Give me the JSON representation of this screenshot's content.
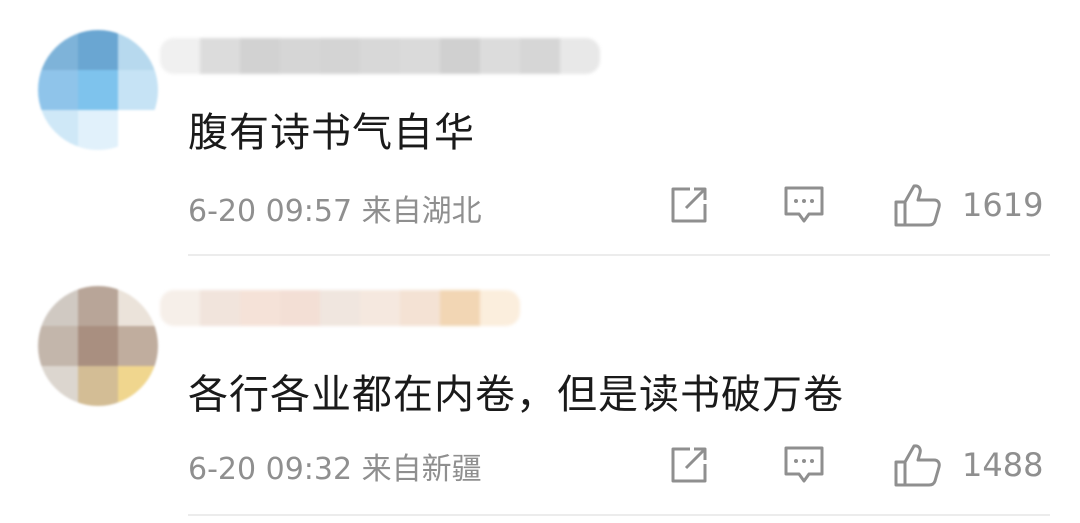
{
  "comments": [
    {
      "text": "腹有诗书气自华",
      "time": "6-20 09:57",
      "location": "来自湖北",
      "likes": "1619",
      "avatar_colors": [
        "#7eb3d9",
        "#6aa6d2",
        "#b7d9ee",
        "#8fc4ea",
        "#7ec3ed",
        "#c6e3f5",
        "#cfe8f7",
        "#e1f1fb",
        "#ffffff"
      ],
      "name_colors": [
        "#f0f0f0",
        "#dcdcdc",
        "#d2d2d2",
        "#d6d6d6",
        "#d4d4d4",
        "#d8d8d8",
        "#dadada",
        "#d0d0d0",
        "#dcdcdc",
        "#d6d6d6",
        "#e8e8e8"
      ]
    },
    {
      "text": "各行各业都在内卷，但是读书破万卷",
      "time": "6-20 09:32",
      "location": "来自新疆",
      "likes": "1488",
      "avatar_colors": [
        "#d0c9c2",
        "#b8a598",
        "#ebe3da",
        "#c3b6ab",
        "#a98f80",
        "#c0ad9e",
        "#dcd6cf",
        "#d3bd95",
        "#f0d68e"
      ],
      "name_colors": [
        "#f6efe9",
        "#f1e4dc",
        "#f5e2d8",
        "#f3dfd5",
        "#f0e6df",
        "#f5e8df",
        "#f4e2d4",
        "#f2d6b4",
        "#fbeedd"
      ]
    }
  ]
}
